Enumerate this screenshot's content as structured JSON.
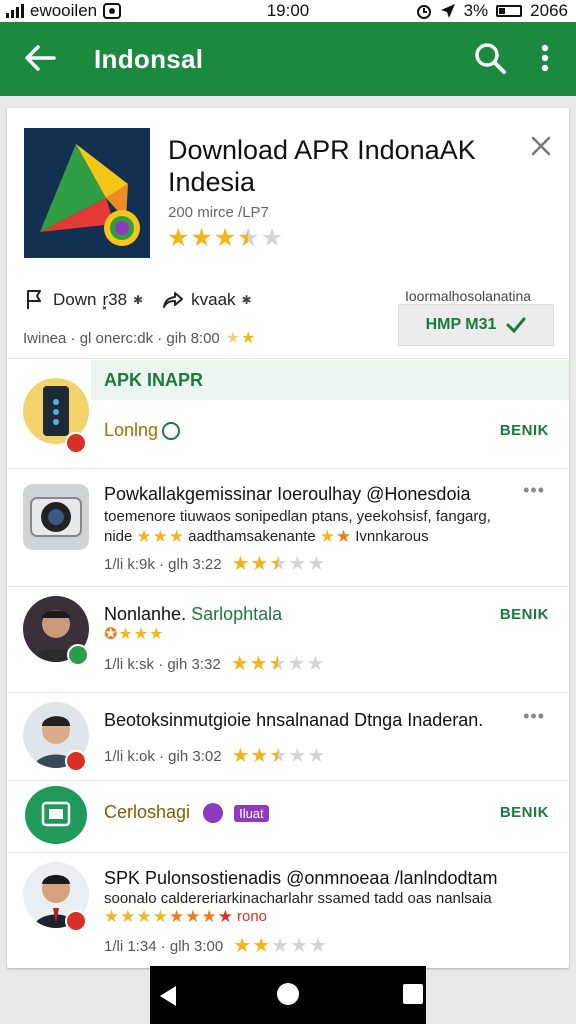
{
  "status": {
    "carrier": "ewooilen",
    "time": "19:00",
    "battery_text": "3%",
    "battery_extra": "2066"
  },
  "appbar": {
    "title": "Indonsal"
  },
  "app": {
    "title": "Download APR IndonaAK Indesia",
    "meta": "200 mirce /LP7",
    "rating": 3.5
  },
  "actions": {
    "down_label": "Down",
    "down_extra": "r͓38",
    "share_label": "kvaak",
    "meta_right": "Ioormalhosolanatina",
    "install_button": "HMP M31",
    "meta_line": "Iwinea · gl onerc:dk · gih 8:00"
  },
  "section": {
    "title": "APK INAPR"
  },
  "rows": [
    {
      "title": "Lonlng",
      "action": "BENIK",
      "avatar": "phone-avatar",
      "badge": "red"
    },
    {
      "title": "Powkallakgemissinar Ioeroulhay @Honesdoia",
      "sub1": "toemenore tiuwaos sonipedlan ptans, yeekohsisf, fangarg,",
      "sub2_a": "nide",
      "sub2_b": "aadthamsakenante",
      "sub2_c": "Ivnnkarous",
      "meta": "1/li k:9k · glh 3:22",
      "rating": 2.5,
      "avatar": "camera-avatar"
    },
    {
      "title_a": "Nonlanhe.",
      "title_b": "Sarlophtala",
      "meta": "1/li k:sk · gih 3:32",
      "action": "BENIK",
      "rating": 2.5,
      "avatar": "person-avatar",
      "badge": "green"
    },
    {
      "title": "Beotoksinmutgioie hnsalnanad Dtnga Inaderan.",
      "meta": "1/li k:ok · gih 3:02",
      "rating": 2.5,
      "avatar": "person-avatar",
      "badge": "red"
    },
    {
      "title": "Cerloshagi",
      "tag": "Iluat",
      "action": "BENIK",
      "avatar": "green-app-avatar"
    },
    {
      "title": "SPK Pulonsostienadis @onmnoeaa /lanlndodtam",
      "sub1": "soonalo caldereriarkinacharlahr ssamed tadd oas nanlsaia",
      "sub_suffix": "rono",
      "meta": "1/li 1:34 · glh 3:00",
      "rating": 2,
      "avatar": "person-avatar",
      "badge": "red"
    }
  ],
  "colors": {
    "appbar": "#1b8a3f",
    "accent": "#1b7b3b",
    "star": "#f2b51c"
  }
}
